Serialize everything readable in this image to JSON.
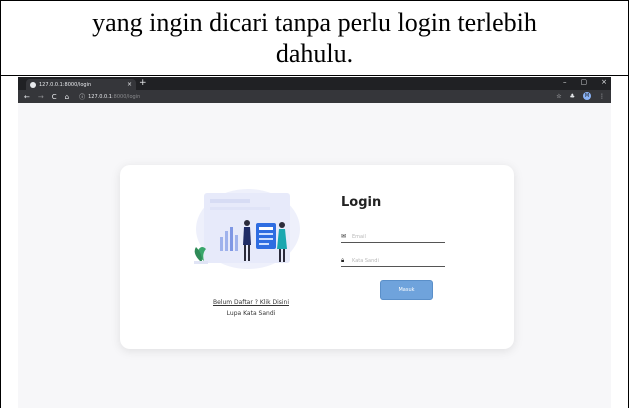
{
  "document": {
    "caption_line1": "yang ingin dicari tanpa perlu login terlebih",
    "caption_line2": "dahulu."
  },
  "browser": {
    "tab_title": "127.0.0.1:8000/login",
    "tab_close": "×",
    "new_tab": "+",
    "window_controls": [
      "–",
      "▢",
      "×"
    ],
    "url_host": "127.0.0.1",
    "url_path": ":8000/login",
    "profile_initial": "M"
  },
  "login": {
    "title": "Login",
    "email_placeholder": "Email",
    "password_placeholder": "Kata Sandi",
    "button_label": "Masuk",
    "register_link": "Belum Daftar ? Klik Disini",
    "forgot_link": "Lupa Kata Sandi"
  },
  "colors": {
    "accent_button": "#6fa3dc",
    "browser_chrome": "#202124",
    "page_background": "#f7f7f9"
  },
  "icons": [
    "back-arrow-icon",
    "forward-arrow-icon",
    "reload-icon",
    "home-icon",
    "info-icon",
    "star-icon",
    "extension-icon",
    "menu-dots-icon",
    "mail-icon",
    "lock-icon"
  ]
}
